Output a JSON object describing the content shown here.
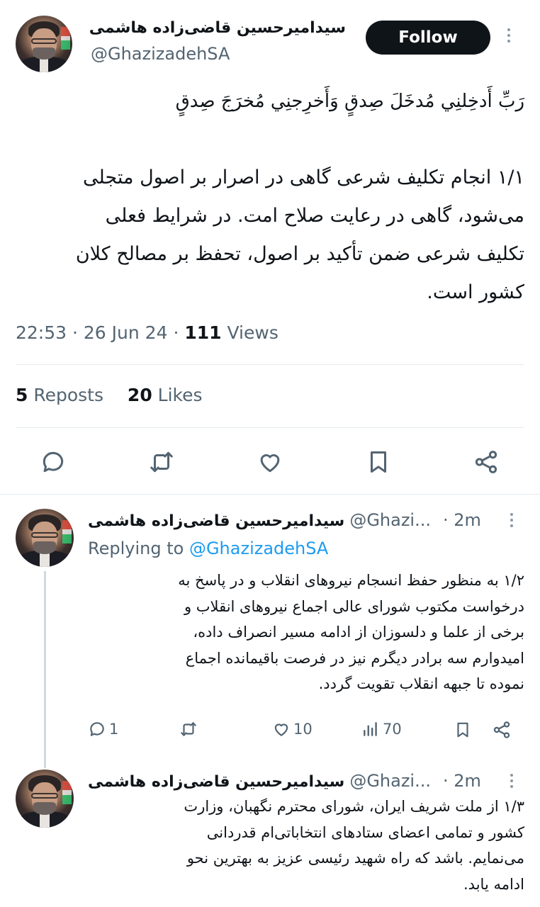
{
  "tweet": {
    "author_name": "سیدامیرحسین قاضی‌زاده هاشمی",
    "handle": "@GhazizadehSA",
    "follow_label": "Follow",
    "text_lines": [
      "رَبِّ أَدخِلنِي مُدخَلَ صِدقٍ وَأَخرِجنِي مُخرَجَ صِدقٍ",
      "",
      "۱/۱ انجام تکلیف شرعی گاهی در اصرار بر اصول متجلی",
      "می‌شود، گاهی در رعایت صلاح امت. در شرایط فعلی",
      "تکلیف شرعی ضمن تأکید بر اصول، تحفظ بر مصالح کلان",
      "کشور است."
    ],
    "time": "22:53",
    "date": "26 Jun 24",
    "views_count": "111",
    "views_label": "Views",
    "reposts_count": "5",
    "reposts_label": "Reposts",
    "likes_count": "20",
    "likes_label": "Likes"
  },
  "replies": [
    {
      "author_name": "سیدامیرحسین قاضی‌زاده هاشمی",
      "handle": "@Ghazi...",
      "time_ago": "· 2m",
      "replying_prefix": "Replying to",
      "replying_handle": "@GhazizadehSA",
      "text_lines": [
        "۱/۲ به منظور حفظ انسجام نیروهای انقلاب و در پاسخ به",
        "درخواست مکتوب شورای عالی اجماع نیروهای انقلاب و",
        "برخی از علما و دلسوزان از ادامه مسیر انصراف داده،",
        "امیدوارم سه برادر دیگرم نیز در فرصت باقیمانده اجماع",
        "نموده تا جبهه انقلاب تقویت گردد."
      ],
      "reply_count": "1",
      "like_count": "10",
      "view_count": "70"
    },
    {
      "author_name": "سیدامیرحسین قاضی‌زاده هاشمی",
      "handle": "@Ghazi...",
      "time_ago": "· 2m",
      "text_lines": [
        "۱/۳ از ملت شریف ایران، شورای محترم نگهبان، وزارت",
        "کشور و تمامی اعضای ستادهای انتخاباتی‌ام قدردانی",
        "می‌نمایم. باشد که راه شهید رئیسی عزیز به بهترین نحو",
        "ادامه یابد."
      ]
    }
  ],
  "icons": {
    "reply": "reply-icon",
    "repost": "repost-icon",
    "like": "heart-icon",
    "bookmark": "bookmark-icon",
    "share": "share-icon",
    "views": "views-icon",
    "more": "more-icon"
  }
}
